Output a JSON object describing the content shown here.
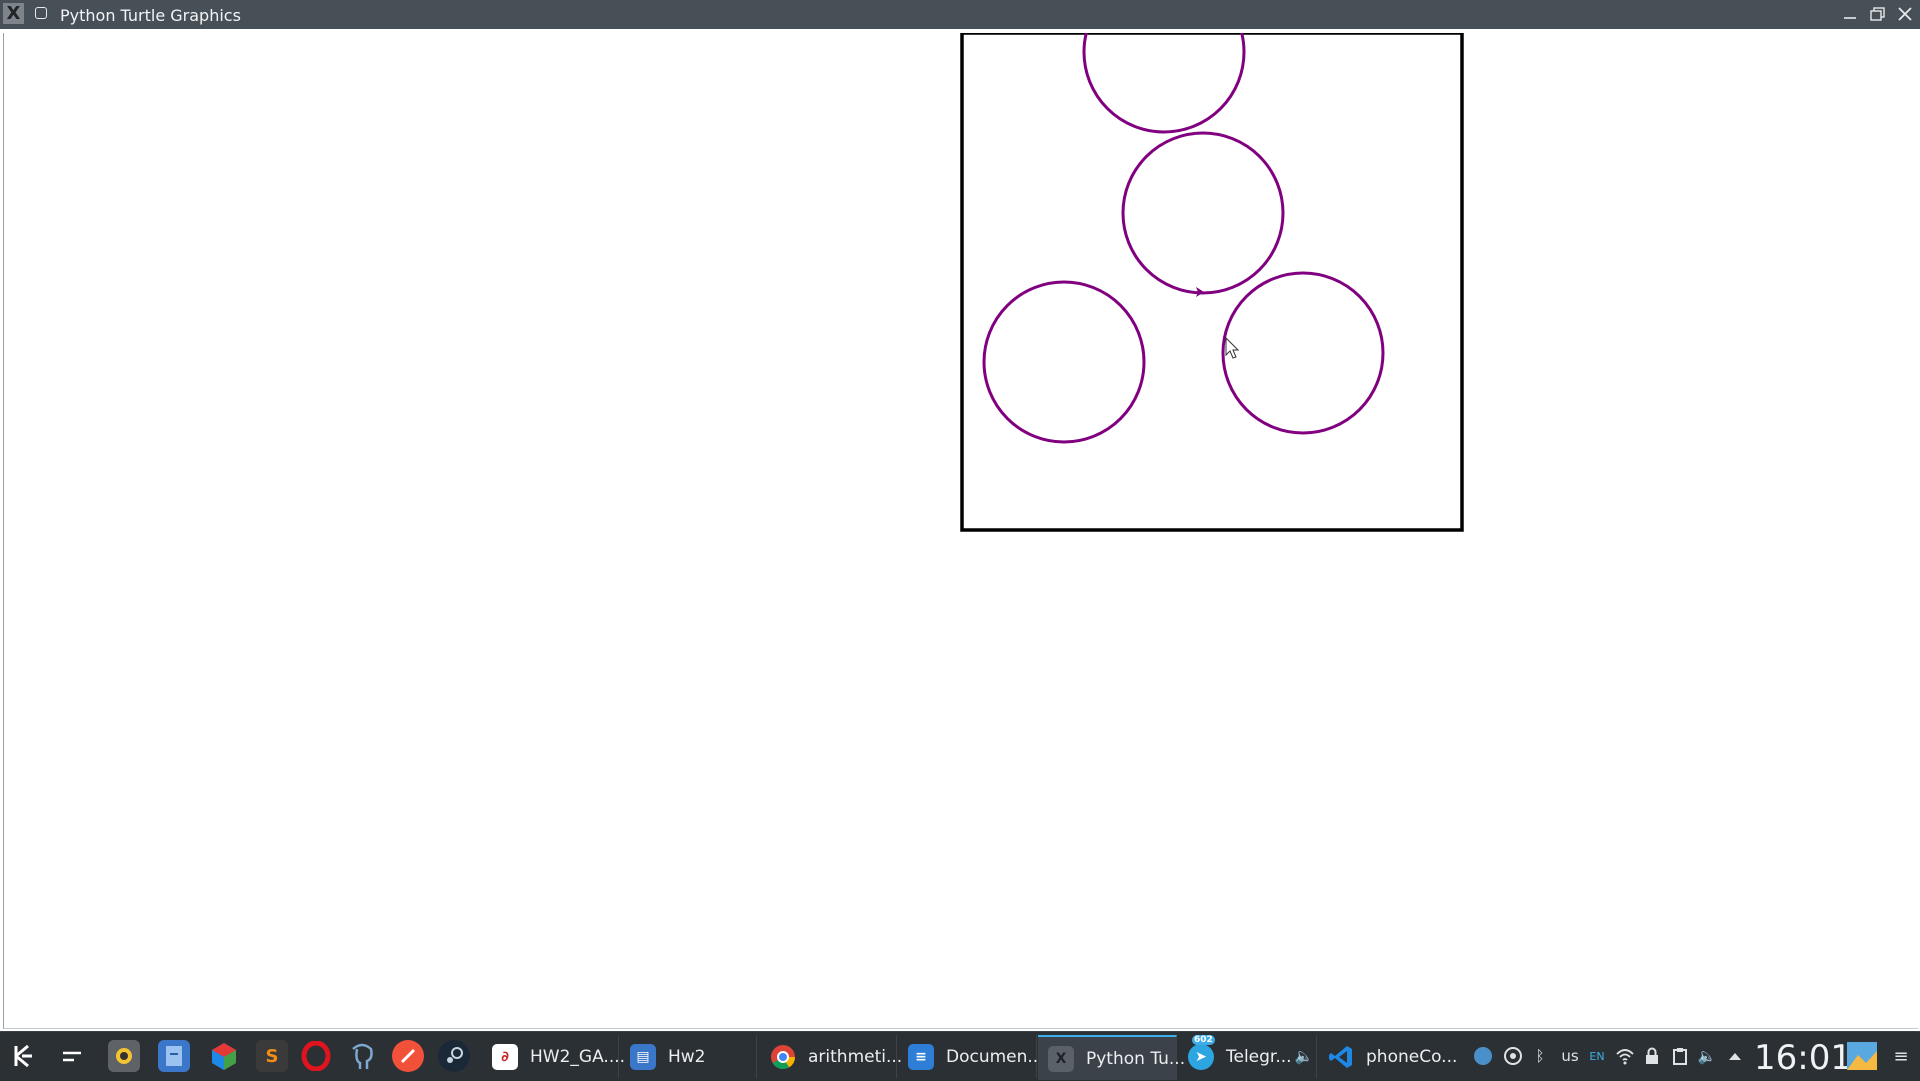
{
  "window": {
    "title": "Python Turtle Graphics",
    "app_icon": "x-window-icon",
    "pin_icon": "keep-above-icon",
    "controls": [
      "minimize-icon",
      "maximize-icon",
      "close-icon"
    ]
  },
  "canvas": {
    "background": "#ffffff",
    "frame_color": "#000000",
    "stroke_color": "#800080",
    "shapes": [
      {
        "kind": "circle",
        "label": "top-circle"
      },
      {
        "kind": "circle",
        "label": "middle-circle"
      },
      {
        "kind": "circle",
        "label": "bottom-left-circle"
      },
      {
        "kind": "circle",
        "label": "bottom-right-circle"
      }
    ],
    "turtle": {
      "shape": "arrow",
      "color": "#800080"
    }
  },
  "taskbar": {
    "launchers": [
      {
        "name": "app-menu-icon",
        "color": "#2b3035"
      },
      {
        "name": "show-desktop-icon",
        "color": "#2b3035"
      },
      {
        "name": "screenshot-app-icon",
        "color": "#5f6368"
      },
      {
        "name": "file-manager-icon",
        "color": "#3a77c9"
      },
      {
        "name": "3d-cube-app-icon",
        "color": "#7e57c2"
      },
      {
        "name": "sublime-text-icon",
        "color": "#f28c18"
      },
      {
        "name": "opera-browser-icon",
        "color": "#d7101e"
      },
      {
        "name": "postgresql-icon",
        "color": "#336791"
      },
      {
        "name": "swift-app-icon",
        "color": "#f05138"
      },
      {
        "name": "steam-icon",
        "color": "#1b2838"
      }
    ],
    "tasks": [
      {
        "label": "HW2_GA....",
        "icon": "pdf-viewer-icon",
        "color": "#c62828"
      },
      {
        "label": "Hw2",
        "icon": "folder-icon",
        "color": "#3a77c9"
      },
      {
        "label": "arithmeti...",
        "icon": "chrome-icon",
        "color": "#4285f4"
      },
      {
        "label": "Documen...",
        "icon": "document-icon",
        "color": "#2e7dd7"
      },
      {
        "label": "Python Tu...",
        "icon": "x-window-icon",
        "color": "#5a6168"
      },
      {
        "label": "Telegr...",
        "icon": "telegram-icon",
        "color": "#2ca5e0",
        "badge": "602"
      },
      {
        "label": "phoneCo...",
        "icon": "vscode-icon",
        "color": "#1e88e5"
      }
    ],
    "tray": {
      "keyboard_layout": "us",
      "lang": "EN",
      "clock": "16:01",
      "icons": [
        "volume-icon",
        "steam-tray-icon",
        "vpn-icon",
        "bluetooth-icon",
        "wifi-icon",
        "lock-icon",
        "clipboard-icon",
        "speaker-icon",
        "expand-tray-icon"
      ]
    }
  }
}
